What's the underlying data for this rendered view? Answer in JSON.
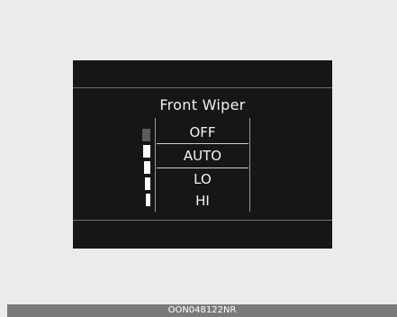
{
  "screen": {
    "title": "Front Wiper",
    "menu_items": [
      "OFF",
      "AUTO",
      "LO",
      "HI"
    ],
    "selected_item": "AUTO",
    "sensitivity_level": {
      "filled": 4,
      "total": 5
    }
  },
  "colors": {
    "display_bg": "#161616",
    "text": "#f2f2f2",
    "level_on": "#ffffff",
    "level_off": "#5b5b5b",
    "caption_bg": "#7a7a7a"
  },
  "caption": "OON048122NR"
}
